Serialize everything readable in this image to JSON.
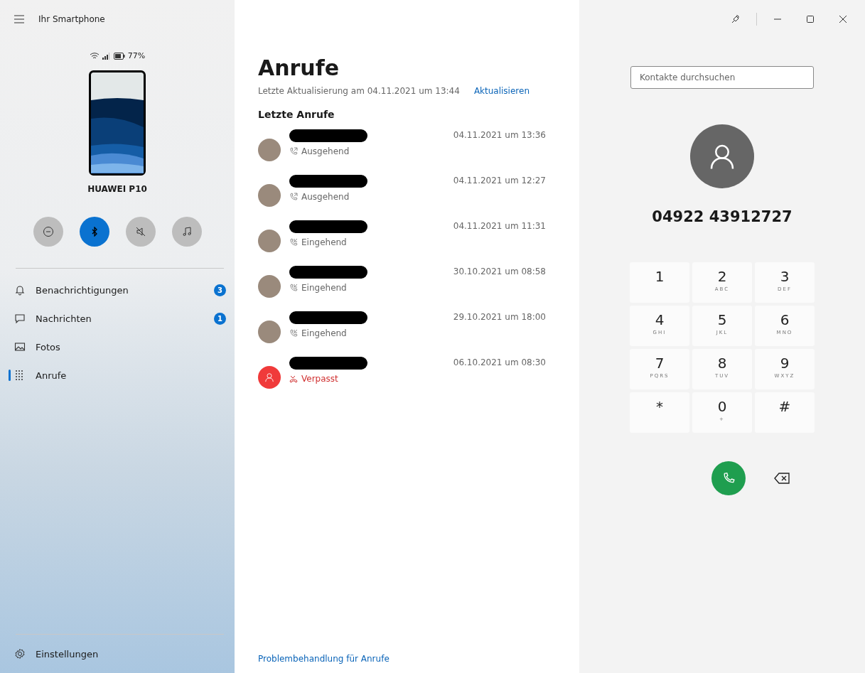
{
  "sidebar": {
    "title": "Ihr Smartphone",
    "battery": "77%",
    "device_name": "HUAWEI P10",
    "toggles": [
      {
        "kind": "dnd",
        "on": false
      },
      {
        "kind": "bluetooth",
        "on": true
      },
      {
        "kind": "mute",
        "on": false
      },
      {
        "kind": "media",
        "on": false
      }
    ],
    "items": [
      {
        "kind": "bell",
        "label": "Benachrichtigungen",
        "badge": "3",
        "selected": false
      },
      {
        "kind": "message",
        "label": "Nachrichten",
        "badge": "1",
        "selected": false
      },
      {
        "kind": "photos",
        "label": "Fotos",
        "selected": false
      },
      {
        "kind": "dialpad",
        "label": "Anrufe",
        "selected": true
      }
    ],
    "settings": "Einstellungen"
  },
  "calls_page": {
    "title": "Anrufe",
    "last_update": "Letzte Aktualisierung am 04.11.2021 um 13:44",
    "refresh": "Aktualisieren",
    "section": "Letzte Anrufe",
    "calls": [
      {
        "kind": "outgoing",
        "status": "Ausgehend",
        "time": "04.11.2021 um 13:36"
      },
      {
        "kind": "outgoing",
        "status": "Ausgehend",
        "time": "04.11.2021 um 12:27"
      },
      {
        "kind": "incoming",
        "status": "Eingehend",
        "time": "04.11.2021 um 11:31"
      },
      {
        "kind": "incoming",
        "status": "Eingehend",
        "time": "30.10.2021 um 08:58"
      },
      {
        "kind": "incoming",
        "status": "Eingehend",
        "time": "29.10.2021 um 18:00"
      },
      {
        "kind": "missed",
        "status": "Verpasst",
        "time": "06.10.2021 um 08:30"
      }
    ],
    "troubleshoot": "Problembehandlung für Anrufe"
  },
  "dialer": {
    "search": {
      "placeholder": "Kontakte durchsuchen"
    },
    "number": "04922 43912727",
    "keys": [
      {
        "digit": "1"
      },
      {
        "digit": "2",
        "letters": "ABC"
      },
      {
        "digit": "3",
        "letters": "DEF"
      },
      {
        "digit": "4",
        "letters": "GHI"
      },
      {
        "digit": "5",
        "letters": "JKL"
      },
      {
        "digit": "6",
        "letters": "MNO"
      },
      {
        "digit": "7",
        "letters": "PQRS"
      },
      {
        "digit": "8",
        "letters": "TUV"
      },
      {
        "digit": "9",
        "letters": "WXYZ"
      },
      {
        "digit": "*"
      },
      {
        "digit": "0",
        "letters": "+"
      },
      {
        "digit": "#"
      }
    ]
  }
}
